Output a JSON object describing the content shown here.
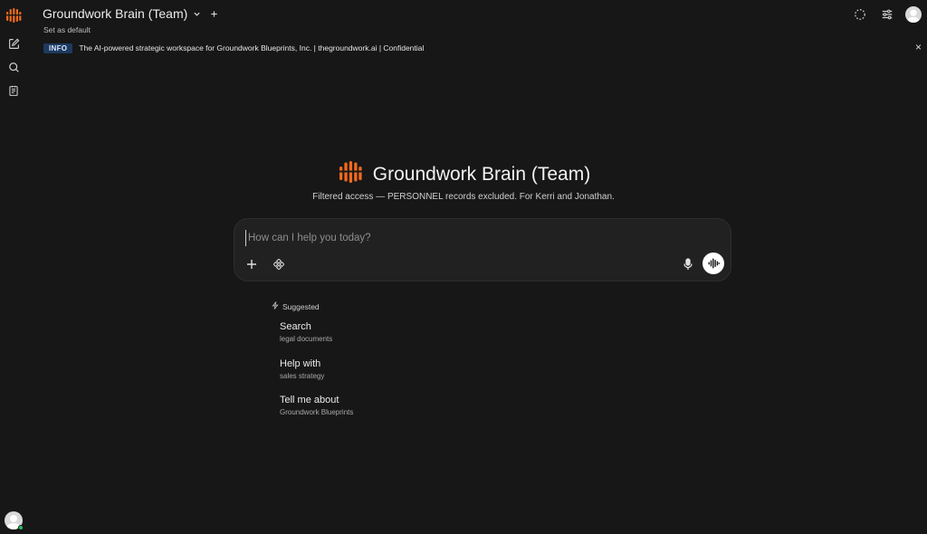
{
  "header": {
    "model_name": "Groundwork Brain (Team)",
    "set_default": "Set as default"
  },
  "banner": {
    "badge": "INFO",
    "text": "The AI-powered strategic workspace for Groundwork Blueprints, Inc. | thegroundwork.ai | Confidential",
    "close": "×"
  },
  "hero": {
    "title": "Groundwork Brain (Team)",
    "subtitle": "Filtered access — PERSONNEL records excluded. For Kerri and Jonathan."
  },
  "chat": {
    "placeholder": "How can I help you today?"
  },
  "suggestions": {
    "label": "Suggested",
    "items": [
      {
        "title": "Search",
        "subtitle": "legal documents"
      },
      {
        "title": "Help with",
        "subtitle": "sales strategy"
      },
      {
        "title": "Tell me about",
        "subtitle": "Groundwork Blueprints"
      }
    ]
  },
  "icons": {
    "sidebar": [
      "logo-icon",
      "new-chat-icon",
      "search-icon",
      "notes-icon"
    ],
    "top_right": [
      "loading-icon",
      "settings-sliders-icon",
      "user-avatar"
    ],
    "chat_tools": [
      "plus-icon",
      "integrations-icon",
      "microphone-icon",
      "voice-mode-icon"
    ]
  },
  "colors": {
    "background": "#171717",
    "brand_orange": "#f26a1b",
    "badge_bg": "#1e3a5f",
    "online": "#22c55e"
  }
}
